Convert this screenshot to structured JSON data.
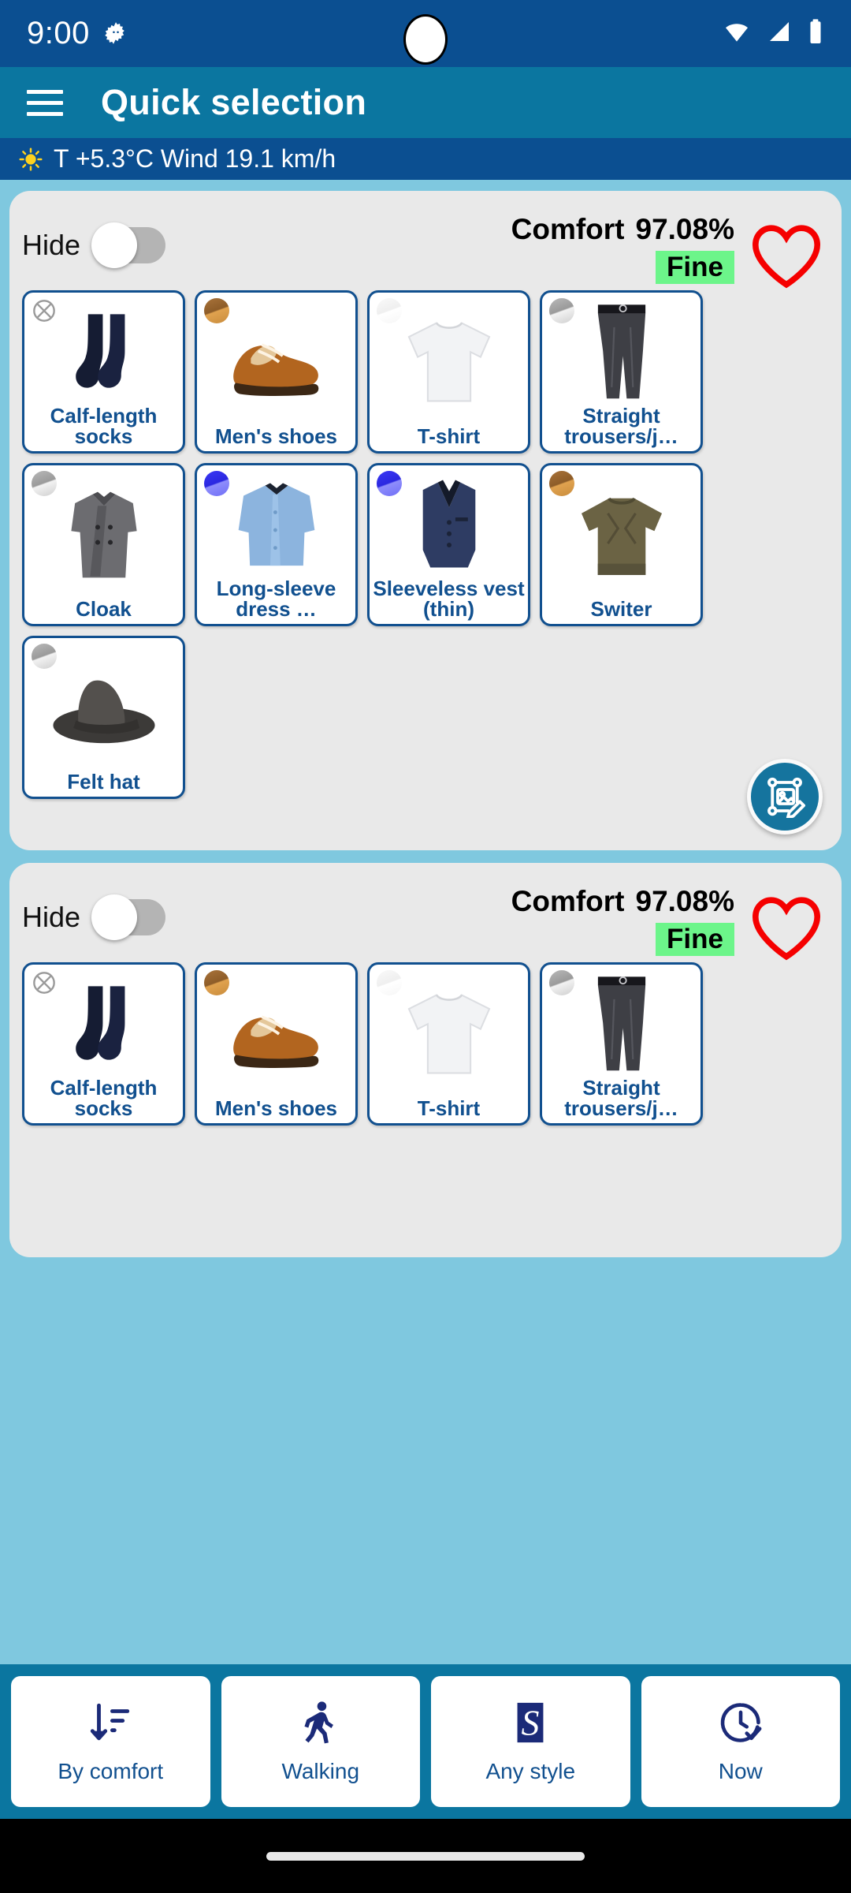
{
  "status_bar": {
    "time": "9:00",
    "icons": [
      "gear-icon",
      "wifi-icon",
      "signal-icon",
      "battery-icon"
    ]
  },
  "app_bar": {
    "menu_icon": "hamburger-menu-icon",
    "title": "Quick selection"
  },
  "weather": {
    "icon": "sun-icon",
    "text": "T  +5.3°C  Wind  19.1  km/h",
    "temperature": "+5.3°C",
    "wind": "19.1 km/h"
  },
  "colors": {
    "status_bar_bg": "#0b4f91",
    "app_bar_bg": "#0b76a0",
    "weather_bg": "#0b4f91",
    "page_bg": "#7fc8df",
    "card_bg": "#e9e9e9",
    "item_border": "#11508f",
    "item_label": "#11508f",
    "fine_badge_bg": "#6cf58a",
    "heart_outline": "#f50000",
    "fab_bg": "#15749e"
  },
  "outfits": [
    {
      "hide_label": "Hide",
      "hide_on": false,
      "comfort_label": "Comfort",
      "comfort_value": "97.08%",
      "rating": "Fine",
      "favorite_icon": "heart-outline-icon",
      "fab_icon": "image-edit-icon",
      "items": [
        {
          "label": "Calf-length socks",
          "art": "socks",
          "badge": "xmark"
        },
        {
          "label": "Men's shoes",
          "art": "shoes",
          "badge": "brown"
        },
        {
          "label": "T-shirt",
          "art": "tshirt",
          "badge": "white"
        },
        {
          "label": "Straight trousers/j…",
          "art": "trousers",
          "badge": "gray"
        },
        {
          "label": "Cloak",
          "art": "coat",
          "badge": "gray"
        },
        {
          "label": "Long-sleeve dress …",
          "art": "shirt",
          "badge": "blue"
        },
        {
          "label": "Sleeveless vest (thin)",
          "art": "vest",
          "badge": "blue"
        },
        {
          "label": "Switer",
          "art": "sweater",
          "badge": "brown"
        },
        {
          "label": "Felt hat",
          "art": "hat",
          "badge": "gray"
        }
      ]
    },
    {
      "hide_label": "Hide",
      "hide_on": false,
      "comfort_label": "Comfort",
      "comfort_value": "97.08%",
      "rating": "Fine",
      "favorite_icon": "heart-outline-icon",
      "items": [
        {
          "label": "Calf-length socks",
          "art": "socks",
          "badge": "xmark"
        },
        {
          "label": "Men's shoes",
          "art": "shoes",
          "badge": "brown"
        },
        {
          "label": "T-shirt",
          "art": "tshirt",
          "badge": "white"
        },
        {
          "label": "Straight trousers/j…",
          "art": "trousers",
          "badge": "gray"
        }
      ]
    }
  ],
  "bottom_nav": [
    {
      "label": "By comfort",
      "icon": "sort-descending-icon"
    },
    {
      "label": "Walking",
      "icon": "walking-person-icon"
    },
    {
      "label": "Any style",
      "icon": "style-s-icon"
    },
    {
      "label": "Now",
      "icon": "clock-check-icon"
    }
  ]
}
